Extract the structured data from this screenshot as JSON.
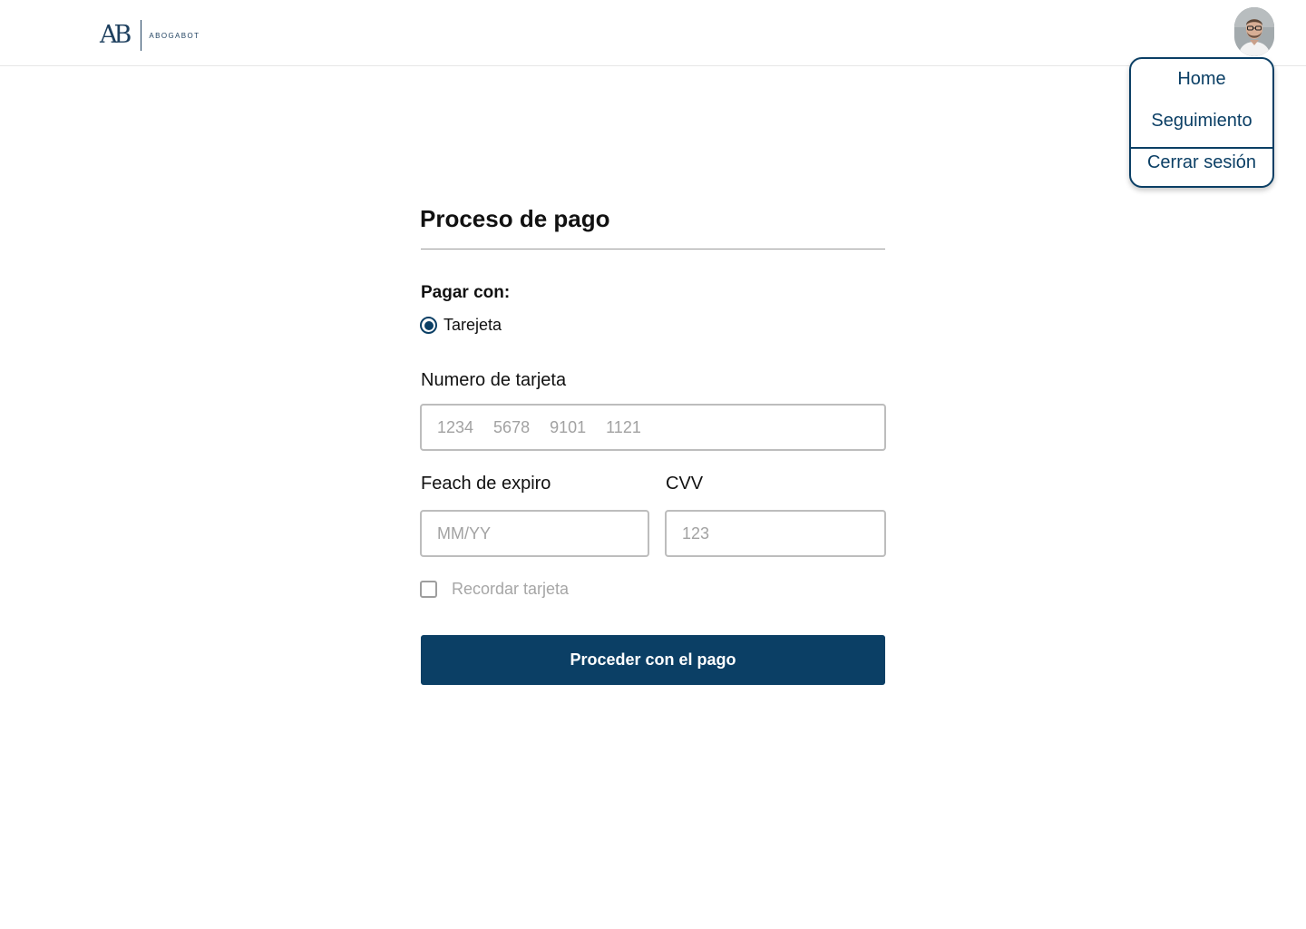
{
  "header": {
    "logo": {
      "mark": "AB",
      "text": "ABOGABOT",
      "icon": "abogabot-logo-icon"
    },
    "avatar": {
      "icon": "user-avatar-icon"
    }
  },
  "menu": {
    "items": [
      {
        "label": "Home"
      },
      {
        "label": "Seguimiento"
      },
      {
        "label": "Cerrar sesión"
      }
    ]
  },
  "form": {
    "title": "Proceso de pago",
    "pay_with_label": "Pagar con:",
    "payment_option": {
      "label": "Tarejeta",
      "selected": true
    },
    "card_number": {
      "label": "Numero de tarjeta",
      "placeholder": "1234  5678  9101  1121",
      "value": ""
    },
    "expiry": {
      "label": "Feach de expiro",
      "placeholder": "MM/YY",
      "value": ""
    },
    "cvv": {
      "label": "CVV",
      "placeholder": "123",
      "value": ""
    },
    "remember": {
      "label": "Recordar tarjeta",
      "checked": false
    },
    "submit_label": "Proceder con el pago"
  },
  "colors": {
    "brand": "#0b3f65",
    "logo": "#1d3f5e",
    "border": "#bdbdbd",
    "placeholder": "#a2a2a2",
    "divider": "#9a9a9a"
  }
}
